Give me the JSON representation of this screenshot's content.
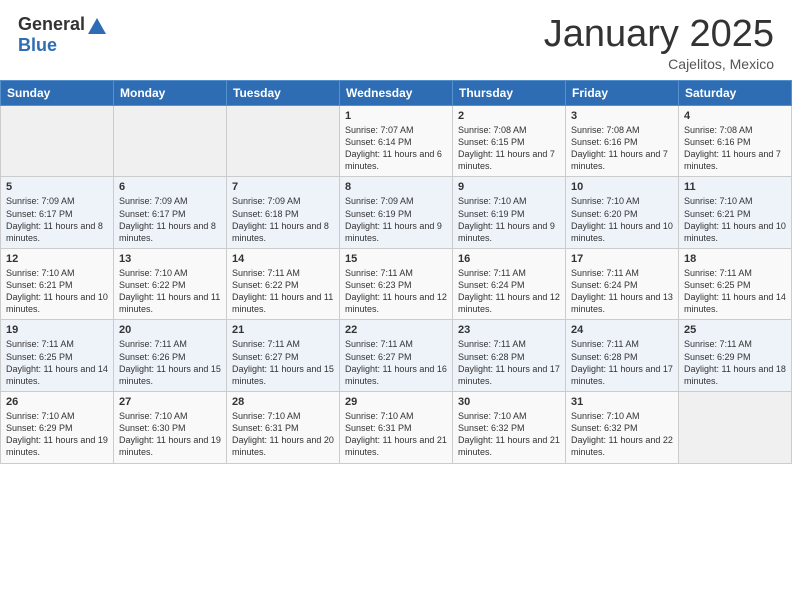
{
  "header": {
    "logo_general": "General",
    "logo_blue": "Blue",
    "month": "January 2025",
    "location": "Cajelitos, Mexico"
  },
  "days_of_week": [
    "Sunday",
    "Monday",
    "Tuesday",
    "Wednesday",
    "Thursday",
    "Friday",
    "Saturday"
  ],
  "weeks": [
    [
      {
        "day": "",
        "sunrise": "",
        "sunset": "",
        "daylight": ""
      },
      {
        "day": "",
        "sunrise": "",
        "sunset": "",
        "daylight": ""
      },
      {
        "day": "",
        "sunrise": "",
        "sunset": "",
        "daylight": ""
      },
      {
        "day": "1",
        "sunrise": "Sunrise: 7:07 AM",
        "sunset": "Sunset: 6:14 PM",
        "daylight": "Daylight: 11 hours and 6 minutes."
      },
      {
        "day": "2",
        "sunrise": "Sunrise: 7:08 AM",
        "sunset": "Sunset: 6:15 PM",
        "daylight": "Daylight: 11 hours and 7 minutes."
      },
      {
        "day": "3",
        "sunrise": "Sunrise: 7:08 AM",
        "sunset": "Sunset: 6:16 PM",
        "daylight": "Daylight: 11 hours and 7 minutes."
      },
      {
        "day": "4",
        "sunrise": "Sunrise: 7:08 AM",
        "sunset": "Sunset: 6:16 PM",
        "daylight": "Daylight: 11 hours and 7 minutes."
      }
    ],
    [
      {
        "day": "5",
        "sunrise": "Sunrise: 7:09 AM",
        "sunset": "Sunset: 6:17 PM",
        "daylight": "Daylight: 11 hours and 8 minutes."
      },
      {
        "day": "6",
        "sunrise": "Sunrise: 7:09 AM",
        "sunset": "Sunset: 6:17 PM",
        "daylight": "Daylight: 11 hours and 8 minutes."
      },
      {
        "day": "7",
        "sunrise": "Sunrise: 7:09 AM",
        "sunset": "Sunset: 6:18 PM",
        "daylight": "Daylight: 11 hours and 8 minutes."
      },
      {
        "day": "8",
        "sunrise": "Sunrise: 7:09 AM",
        "sunset": "Sunset: 6:19 PM",
        "daylight": "Daylight: 11 hours and 9 minutes."
      },
      {
        "day": "9",
        "sunrise": "Sunrise: 7:10 AM",
        "sunset": "Sunset: 6:19 PM",
        "daylight": "Daylight: 11 hours and 9 minutes."
      },
      {
        "day": "10",
        "sunrise": "Sunrise: 7:10 AM",
        "sunset": "Sunset: 6:20 PM",
        "daylight": "Daylight: 11 hours and 10 minutes."
      },
      {
        "day": "11",
        "sunrise": "Sunrise: 7:10 AM",
        "sunset": "Sunset: 6:21 PM",
        "daylight": "Daylight: 11 hours and 10 minutes."
      }
    ],
    [
      {
        "day": "12",
        "sunrise": "Sunrise: 7:10 AM",
        "sunset": "Sunset: 6:21 PM",
        "daylight": "Daylight: 11 hours and 10 minutes."
      },
      {
        "day": "13",
        "sunrise": "Sunrise: 7:10 AM",
        "sunset": "Sunset: 6:22 PM",
        "daylight": "Daylight: 11 hours and 11 minutes."
      },
      {
        "day": "14",
        "sunrise": "Sunrise: 7:11 AM",
        "sunset": "Sunset: 6:22 PM",
        "daylight": "Daylight: 11 hours and 11 minutes."
      },
      {
        "day": "15",
        "sunrise": "Sunrise: 7:11 AM",
        "sunset": "Sunset: 6:23 PM",
        "daylight": "Daylight: 11 hours and 12 minutes."
      },
      {
        "day": "16",
        "sunrise": "Sunrise: 7:11 AM",
        "sunset": "Sunset: 6:24 PM",
        "daylight": "Daylight: 11 hours and 12 minutes."
      },
      {
        "day": "17",
        "sunrise": "Sunrise: 7:11 AM",
        "sunset": "Sunset: 6:24 PM",
        "daylight": "Daylight: 11 hours and 13 minutes."
      },
      {
        "day": "18",
        "sunrise": "Sunrise: 7:11 AM",
        "sunset": "Sunset: 6:25 PM",
        "daylight": "Daylight: 11 hours and 14 minutes."
      }
    ],
    [
      {
        "day": "19",
        "sunrise": "Sunrise: 7:11 AM",
        "sunset": "Sunset: 6:25 PM",
        "daylight": "Daylight: 11 hours and 14 minutes."
      },
      {
        "day": "20",
        "sunrise": "Sunrise: 7:11 AM",
        "sunset": "Sunset: 6:26 PM",
        "daylight": "Daylight: 11 hours and 15 minutes."
      },
      {
        "day": "21",
        "sunrise": "Sunrise: 7:11 AM",
        "sunset": "Sunset: 6:27 PM",
        "daylight": "Daylight: 11 hours and 15 minutes."
      },
      {
        "day": "22",
        "sunrise": "Sunrise: 7:11 AM",
        "sunset": "Sunset: 6:27 PM",
        "daylight": "Daylight: 11 hours and 16 minutes."
      },
      {
        "day": "23",
        "sunrise": "Sunrise: 7:11 AM",
        "sunset": "Sunset: 6:28 PM",
        "daylight": "Daylight: 11 hours and 17 minutes."
      },
      {
        "day": "24",
        "sunrise": "Sunrise: 7:11 AM",
        "sunset": "Sunset: 6:28 PM",
        "daylight": "Daylight: 11 hours and 17 minutes."
      },
      {
        "day": "25",
        "sunrise": "Sunrise: 7:11 AM",
        "sunset": "Sunset: 6:29 PM",
        "daylight": "Daylight: 11 hours and 18 minutes."
      }
    ],
    [
      {
        "day": "26",
        "sunrise": "Sunrise: 7:10 AM",
        "sunset": "Sunset: 6:29 PM",
        "daylight": "Daylight: 11 hours and 19 minutes."
      },
      {
        "day": "27",
        "sunrise": "Sunrise: 7:10 AM",
        "sunset": "Sunset: 6:30 PM",
        "daylight": "Daylight: 11 hours and 19 minutes."
      },
      {
        "day": "28",
        "sunrise": "Sunrise: 7:10 AM",
        "sunset": "Sunset: 6:31 PM",
        "daylight": "Daylight: 11 hours and 20 minutes."
      },
      {
        "day": "29",
        "sunrise": "Sunrise: 7:10 AM",
        "sunset": "Sunset: 6:31 PM",
        "daylight": "Daylight: 11 hours and 21 minutes."
      },
      {
        "day": "30",
        "sunrise": "Sunrise: 7:10 AM",
        "sunset": "Sunset: 6:32 PM",
        "daylight": "Daylight: 11 hours and 21 minutes."
      },
      {
        "day": "31",
        "sunrise": "Sunrise: 7:10 AM",
        "sunset": "Sunset: 6:32 PM",
        "daylight": "Daylight: 11 hours and 22 minutes."
      },
      {
        "day": "",
        "sunrise": "",
        "sunset": "",
        "daylight": ""
      }
    ]
  ]
}
